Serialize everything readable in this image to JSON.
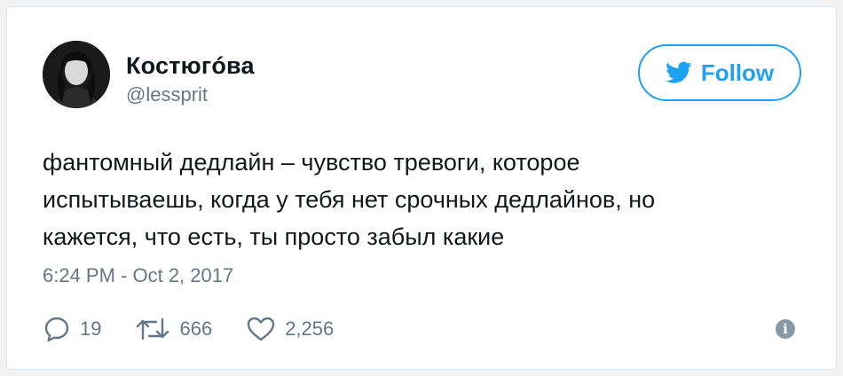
{
  "user": {
    "name": "Костюгóва",
    "handle": "@lessprit"
  },
  "follow_button": {
    "label": "Follow",
    "icon": "twitter-bird-icon"
  },
  "tweet": {
    "lines": [
      "фантомный дедлайн – чувство тревоги, которое",
      "испытываешь, когда у тебя нет срочных дедлайнов, но",
      "кажется, что есть, ты просто забыл какие"
    ],
    "timestamp": "6:24 PM - Oct 2, 2017"
  },
  "actions": {
    "replies": "19",
    "retweets": "666",
    "likes": "2,256"
  },
  "colors": {
    "accent": "#1da1f2",
    "muted": "#657786",
    "text": "#14171a"
  }
}
